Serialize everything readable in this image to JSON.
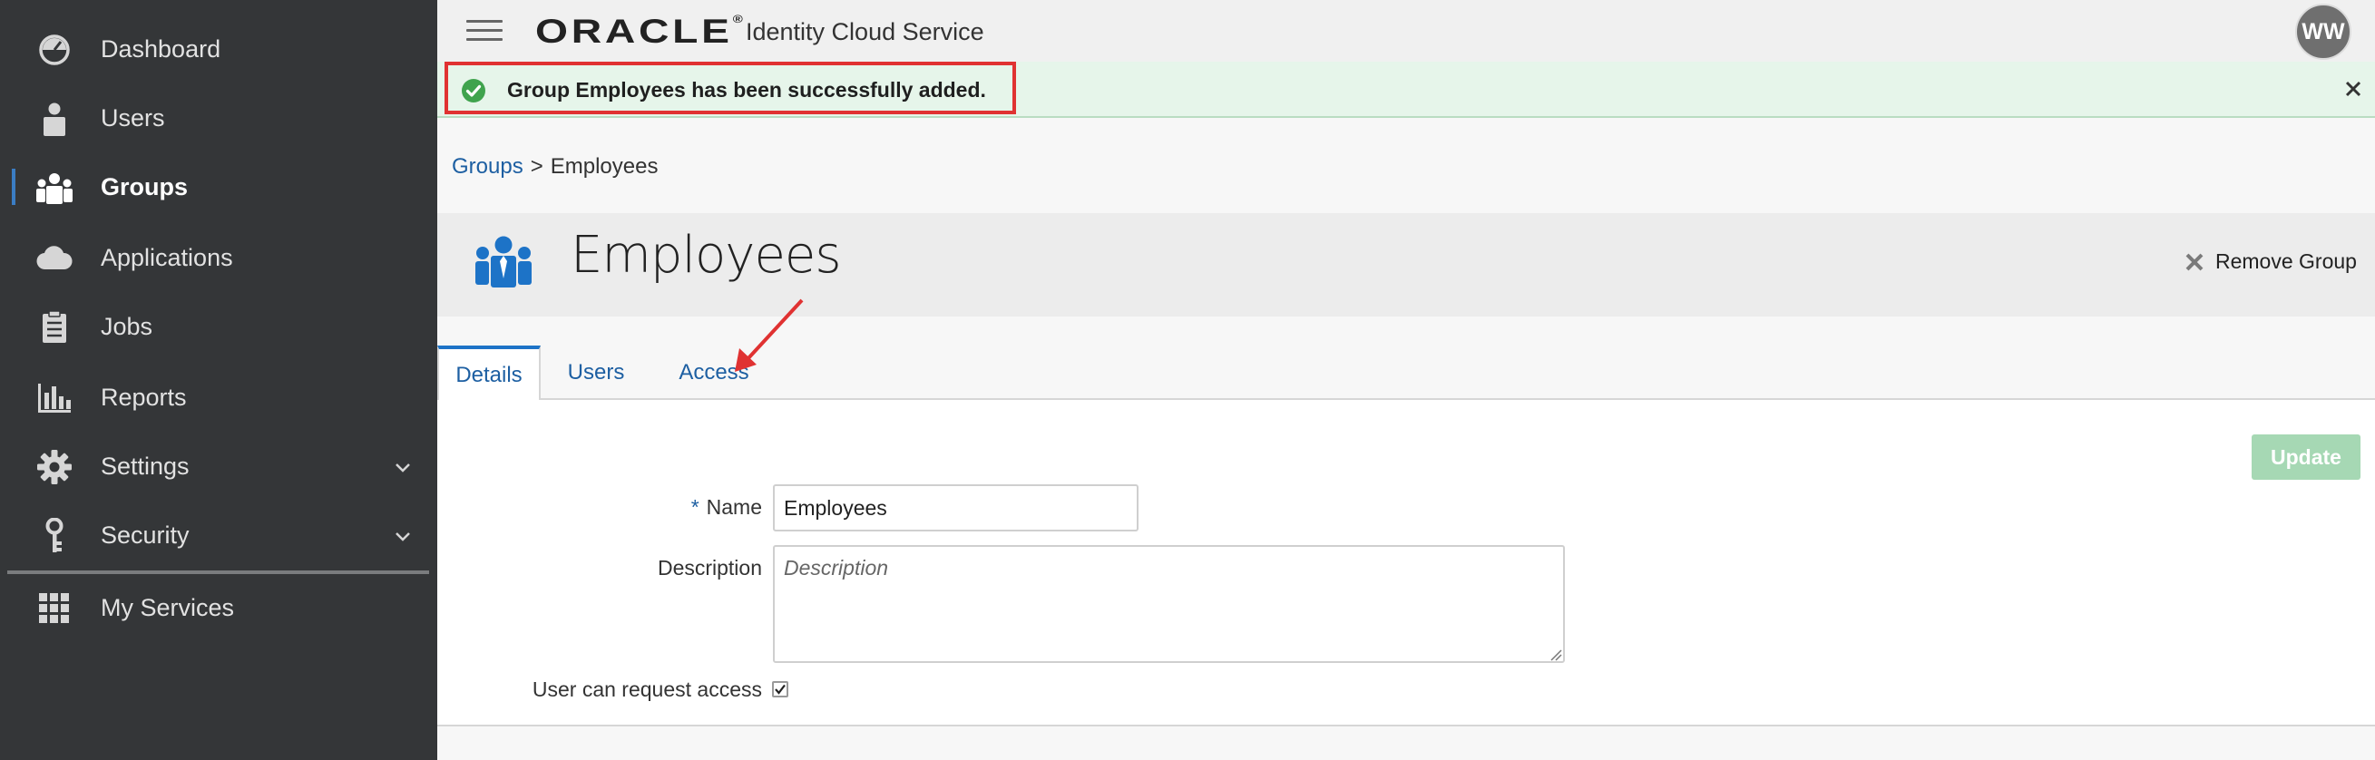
{
  "sidebar": {
    "items": [
      {
        "label": "Dashboard",
        "icon": "dashboard-icon"
      },
      {
        "label": "Users",
        "icon": "user-icon"
      },
      {
        "label": "Groups",
        "icon": "groups-icon",
        "active": true
      },
      {
        "label": "Applications",
        "icon": "cloud-icon"
      },
      {
        "label": "Jobs",
        "icon": "jobs-icon"
      },
      {
        "label": "Reports",
        "icon": "reports-icon"
      },
      {
        "label": "Settings",
        "icon": "gear-icon",
        "expandable": true
      },
      {
        "label": "Security",
        "icon": "key-icon",
        "expandable": true
      },
      {
        "label": "My Services",
        "icon": "grid-icon"
      }
    ]
  },
  "header": {
    "brand": "ORACLE",
    "product": "Identity Cloud Service",
    "avatar_initials": "WW"
  },
  "banner": {
    "message": "Group Employees has been successfully added."
  },
  "breadcrumb": {
    "parent": "Groups",
    "separator": ">",
    "current": "Employees"
  },
  "page": {
    "title": "Employees",
    "remove_label": "Remove Group"
  },
  "tabs": [
    {
      "label": "Details",
      "active": true
    },
    {
      "label": "Users"
    },
    {
      "label": "Access"
    }
  ],
  "form": {
    "update_label": "Update",
    "required_marker": "*",
    "name_label": "Name",
    "name_value": "Employees",
    "description_label": "Description",
    "description_placeholder": "Description",
    "request_access_label": "User can request access",
    "request_access_checked": true
  },
  "colors": {
    "sidebar_bg": "#343638",
    "accent": "#1d5fa2",
    "success_bg": "#e6f5ea",
    "success_icon": "#3fa34d",
    "highlight": "#e03232",
    "update_disabled": "#a6d8b4"
  }
}
